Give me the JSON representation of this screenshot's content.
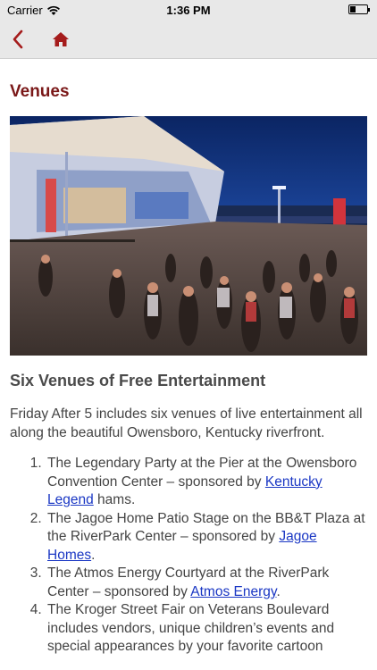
{
  "status_bar": {
    "carrier": "Carrier",
    "time": "1:36 PM",
    "battery_level": 0.35
  },
  "nav": {
    "back_icon": "chevron-left-icon",
    "home_icon": "home-icon",
    "accent_color": "#a51c1c"
  },
  "page": {
    "title": "Venues",
    "title_color": "#7a1818"
  },
  "content": {
    "heading": "Six Venues of Free Entertainment",
    "intro": "Friday After 5 includes six venues of live entertainment all along the beautiful Owensboro, Kentucky riverfront.",
    "venues": [
      {
        "text_before": "The Legendary Party at the Pier at the Owensboro Convention Center – sponsored by ",
        "link": "Kentucky Legend",
        "text_after": " hams."
      },
      {
        "text_before": "The Jagoe Home Patio Stage on the BB&T Plaza at the RiverPark Center – sponsored by ",
        "link": "Jagoe Homes",
        "text_after": "."
      },
      {
        "text_before": "The Atmos Energy Courtyard at the RiverPark Center  – sponsored by ",
        "link": "Atmos Energy",
        "text_after": "."
      },
      {
        "text_before": "The Kroger Street Fair on Veterans Boulevard includes vendors, unique children’s events and special appearances by your favorite cartoon",
        "link": "",
        "text_after": ""
      }
    ]
  }
}
